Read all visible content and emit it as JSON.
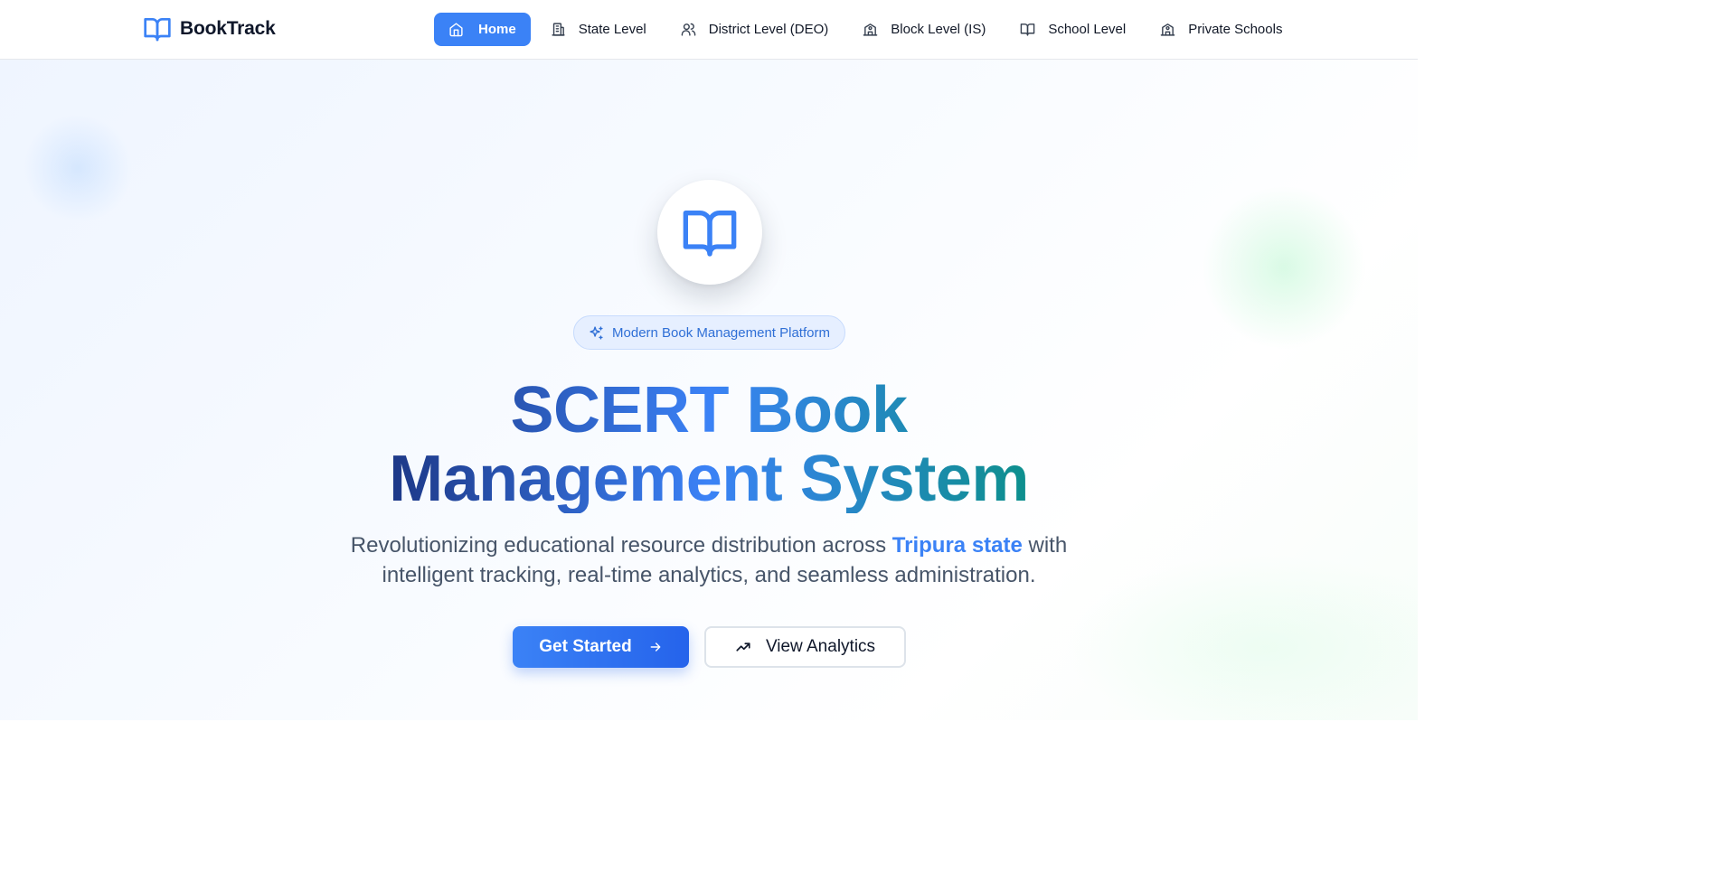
{
  "brand": {
    "name": "BookTrack",
    "icon": "book-open-icon"
  },
  "nav": {
    "items": [
      {
        "label": "Home",
        "icon": "home-icon",
        "active": true
      },
      {
        "label": "State Level",
        "icon": "building-icon",
        "active": false
      },
      {
        "label": "District Level (DEO)",
        "icon": "users-icon",
        "active": false
      },
      {
        "label": "Block Level (IS)",
        "icon": "school-icon",
        "active": false
      },
      {
        "label": "School Level",
        "icon": "book-open-icon",
        "active": false
      },
      {
        "label": "Private Schools",
        "icon": "school-icon",
        "active": false
      }
    ]
  },
  "hero": {
    "badge": "Modern Book Management Platform",
    "title_line1": "SCERT Book",
    "title_line2": "Management System",
    "subtitle_before": "Revolutionizing educational resource distribution across",
    "subtitle_highlight": "Tripura state",
    "subtitle_after": "with intelligent tracking, real-time analytics, and seamless administration.",
    "primary_button": "Get Started",
    "secondary_button": "View Analytics"
  },
  "colors": {
    "accent": "#3b82f6",
    "title_start": "#1e3a8a",
    "title_end": "#0e8f8f",
    "text_muted": "#475569"
  }
}
